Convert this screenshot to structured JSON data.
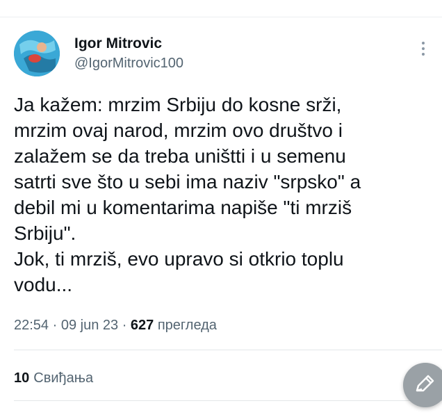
{
  "tweet": {
    "author": {
      "display_name": "Igor Mitrovic",
      "handle": "@IgorMitrovic100"
    },
    "text": "Ja kažem: mrzim Srbiju do kosne srži,\nmrzim ovaj narod, mrzim ovo društvo i\nzalažem se da treba uništti i u semenu\nsatrti sve što u sebi ima naziv \"srpsko\" a\ndebil mi u komentarima napiše \"ti mrziš\nSrbiju\".\nJok, ti mrziš, evo upravo si otkrio toplu\nvodu...",
    "meta": {
      "time": "22:54",
      "separator": " · ",
      "date": "09 jun 23",
      "views_count": "627",
      "views_label": " прегледа"
    },
    "likes": {
      "count": "10",
      "label": "Свиђања"
    }
  },
  "icons": {
    "more": "more-vertical-icon",
    "compose": "pencil-icon"
  }
}
